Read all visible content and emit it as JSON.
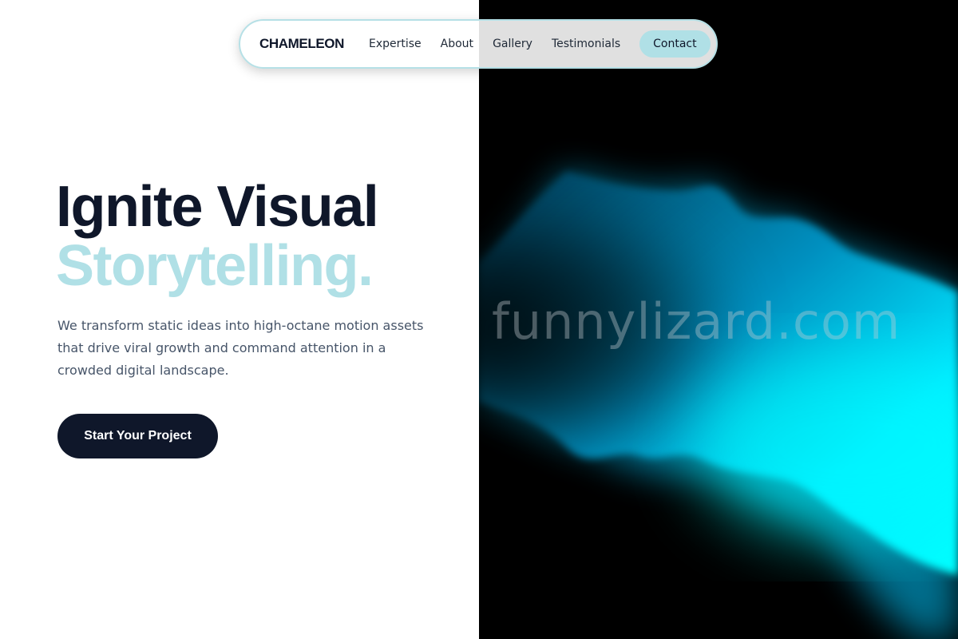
{
  "nav": {
    "brand": "CHAMELEON",
    "links": [
      "Expertise",
      "About",
      "Gallery",
      "Testimonials"
    ],
    "contact_label": "Contact"
  },
  "hero": {
    "title_line1": "Ignite Visual",
    "title_line2": "Storytelling.",
    "description": "We transform static ideas into high-octane motion assets that drive viral growth and command attention in a crowded digital landscape.",
    "cta_label": "Start Your Project"
  },
  "visual": {
    "watermark": "funnylizard.com"
  },
  "colors": {
    "dark": "#0f172a",
    "accent": "#b0e0e6",
    "body_text": "#475569",
    "glow": "#00f0ff"
  }
}
